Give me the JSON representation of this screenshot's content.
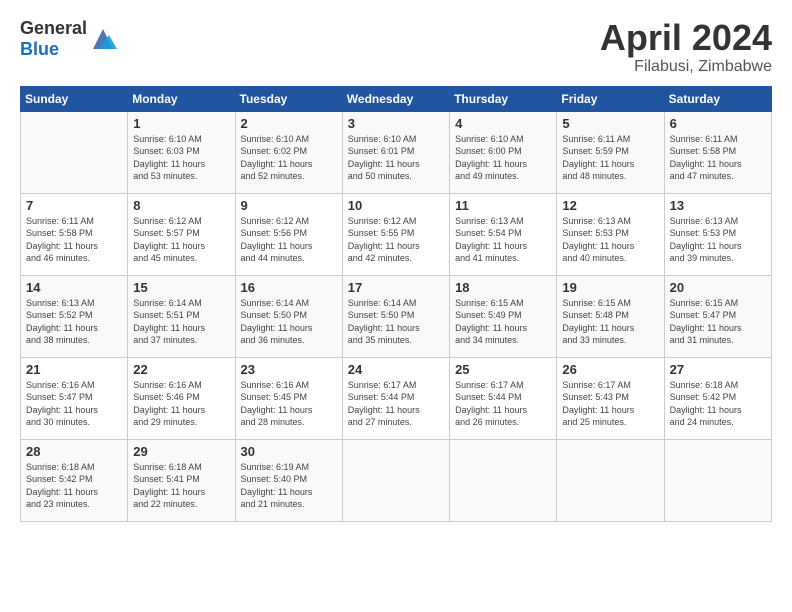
{
  "header": {
    "logo_general": "General",
    "logo_blue": "Blue",
    "month": "April 2024",
    "location": "Filabusi, Zimbabwe"
  },
  "days_of_week": [
    "Sunday",
    "Monday",
    "Tuesday",
    "Wednesday",
    "Thursday",
    "Friday",
    "Saturday"
  ],
  "weeks": [
    [
      {
        "day": "",
        "info": ""
      },
      {
        "day": "1",
        "info": "Sunrise: 6:10 AM\nSunset: 6:03 PM\nDaylight: 11 hours\nand 53 minutes."
      },
      {
        "day": "2",
        "info": "Sunrise: 6:10 AM\nSunset: 6:02 PM\nDaylight: 11 hours\nand 52 minutes."
      },
      {
        "day": "3",
        "info": "Sunrise: 6:10 AM\nSunset: 6:01 PM\nDaylight: 11 hours\nand 50 minutes."
      },
      {
        "day": "4",
        "info": "Sunrise: 6:10 AM\nSunset: 6:00 PM\nDaylight: 11 hours\nand 49 minutes."
      },
      {
        "day": "5",
        "info": "Sunrise: 6:11 AM\nSunset: 5:59 PM\nDaylight: 11 hours\nand 48 minutes."
      },
      {
        "day": "6",
        "info": "Sunrise: 6:11 AM\nSunset: 5:58 PM\nDaylight: 11 hours\nand 47 minutes."
      }
    ],
    [
      {
        "day": "7",
        "info": "Sunrise: 6:11 AM\nSunset: 5:58 PM\nDaylight: 11 hours\nand 46 minutes."
      },
      {
        "day": "8",
        "info": "Sunrise: 6:12 AM\nSunset: 5:57 PM\nDaylight: 11 hours\nand 45 minutes."
      },
      {
        "day": "9",
        "info": "Sunrise: 6:12 AM\nSunset: 5:56 PM\nDaylight: 11 hours\nand 44 minutes."
      },
      {
        "day": "10",
        "info": "Sunrise: 6:12 AM\nSunset: 5:55 PM\nDaylight: 11 hours\nand 42 minutes."
      },
      {
        "day": "11",
        "info": "Sunrise: 6:13 AM\nSunset: 5:54 PM\nDaylight: 11 hours\nand 41 minutes."
      },
      {
        "day": "12",
        "info": "Sunrise: 6:13 AM\nSunset: 5:53 PM\nDaylight: 11 hours\nand 40 minutes."
      },
      {
        "day": "13",
        "info": "Sunrise: 6:13 AM\nSunset: 5:53 PM\nDaylight: 11 hours\nand 39 minutes."
      }
    ],
    [
      {
        "day": "14",
        "info": "Sunrise: 6:13 AM\nSunset: 5:52 PM\nDaylight: 11 hours\nand 38 minutes."
      },
      {
        "day": "15",
        "info": "Sunrise: 6:14 AM\nSunset: 5:51 PM\nDaylight: 11 hours\nand 37 minutes."
      },
      {
        "day": "16",
        "info": "Sunrise: 6:14 AM\nSunset: 5:50 PM\nDaylight: 11 hours\nand 36 minutes."
      },
      {
        "day": "17",
        "info": "Sunrise: 6:14 AM\nSunset: 5:50 PM\nDaylight: 11 hours\nand 35 minutes."
      },
      {
        "day": "18",
        "info": "Sunrise: 6:15 AM\nSunset: 5:49 PM\nDaylight: 11 hours\nand 34 minutes."
      },
      {
        "day": "19",
        "info": "Sunrise: 6:15 AM\nSunset: 5:48 PM\nDaylight: 11 hours\nand 33 minutes."
      },
      {
        "day": "20",
        "info": "Sunrise: 6:15 AM\nSunset: 5:47 PM\nDaylight: 11 hours\nand 31 minutes."
      }
    ],
    [
      {
        "day": "21",
        "info": "Sunrise: 6:16 AM\nSunset: 5:47 PM\nDaylight: 11 hours\nand 30 minutes."
      },
      {
        "day": "22",
        "info": "Sunrise: 6:16 AM\nSunset: 5:46 PM\nDaylight: 11 hours\nand 29 minutes."
      },
      {
        "day": "23",
        "info": "Sunrise: 6:16 AM\nSunset: 5:45 PM\nDaylight: 11 hours\nand 28 minutes."
      },
      {
        "day": "24",
        "info": "Sunrise: 6:17 AM\nSunset: 5:44 PM\nDaylight: 11 hours\nand 27 minutes."
      },
      {
        "day": "25",
        "info": "Sunrise: 6:17 AM\nSunset: 5:44 PM\nDaylight: 11 hours\nand 26 minutes."
      },
      {
        "day": "26",
        "info": "Sunrise: 6:17 AM\nSunset: 5:43 PM\nDaylight: 11 hours\nand 25 minutes."
      },
      {
        "day": "27",
        "info": "Sunrise: 6:18 AM\nSunset: 5:42 PM\nDaylight: 11 hours\nand 24 minutes."
      }
    ],
    [
      {
        "day": "28",
        "info": "Sunrise: 6:18 AM\nSunset: 5:42 PM\nDaylight: 11 hours\nand 23 minutes."
      },
      {
        "day": "29",
        "info": "Sunrise: 6:18 AM\nSunset: 5:41 PM\nDaylight: 11 hours\nand 22 minutes."
      },
      {
        "day": "30",
        "info": "Sunrise: 6:19 AM\nSunset: 5:40 PM\nDaylight: 11 hours\nand 21 minutes."
      },
      {
        "day": "",
        "info": ""
      },
      {
        "day": "",
        "info": ""
      },
      {
        "day": "",
        "info": ""
      },
      {
        "day": "",
        "info": ""
      }
    ]
  ]
}
